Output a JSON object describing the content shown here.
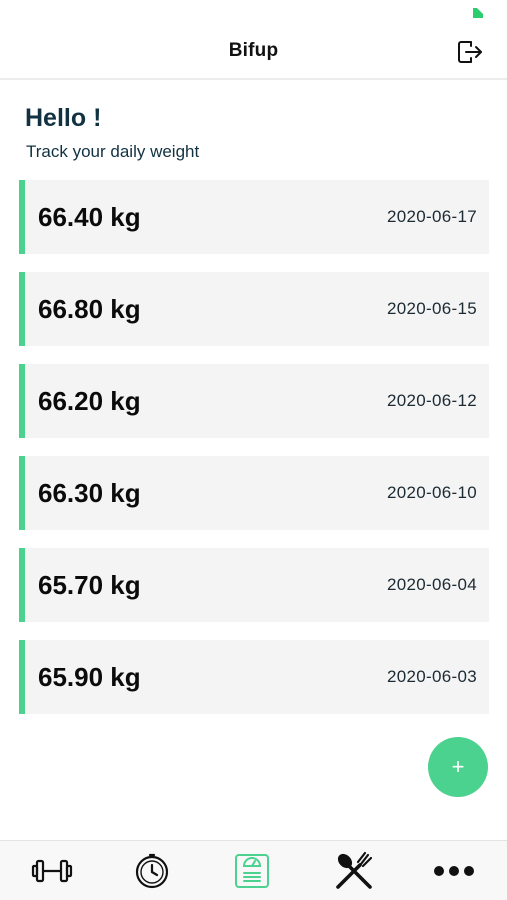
{
  "header": {
    "title": "Bifup",
    "logout_icon": "logout-icon"
  },
  "main": {
    "greeting": "Hello !",
    "subtitle": "Track your daily weight",
    "accent_color": "#4cd28f",
    "entries": [
      {
        "weight": "66.40 kg",
        "date": "2020-06-17"
      },
      {
        "weight": "66.80 kg",
        "date": "2020-06-15"
      },
      {
        "weight": "66.20 kg",
        "date": "2020-06-12"
      },
      {
        "weight": "66.30 kg",
        "date": "2020-06-10"
      },
      {
        "weight": "65.70 kg",
        "date": "2020-06-04"
      },
      {
        "weight": "65.90 kg",
        "date": "2020-06-03"
      }
    ]
  },
  "fab": {
    "label": "+",
    "color": "#4cd28f"
  },
  "tab_bar": {
    "items": [
      {
        "icon": "dumbbell-icon",
        "active": false
      },
      {
        "icon": "stopwatch-icon",
        "active": false
      },
      {
        "icon": "scale-icon",
        "active": true
      },
      {
        "icon": "fork-spoon-icon",
        "active": false
      },
      {
        "icon": "more-icon",
        "active": false
      }
    ],
    "active_color": "#4cd28f"
  }
}
